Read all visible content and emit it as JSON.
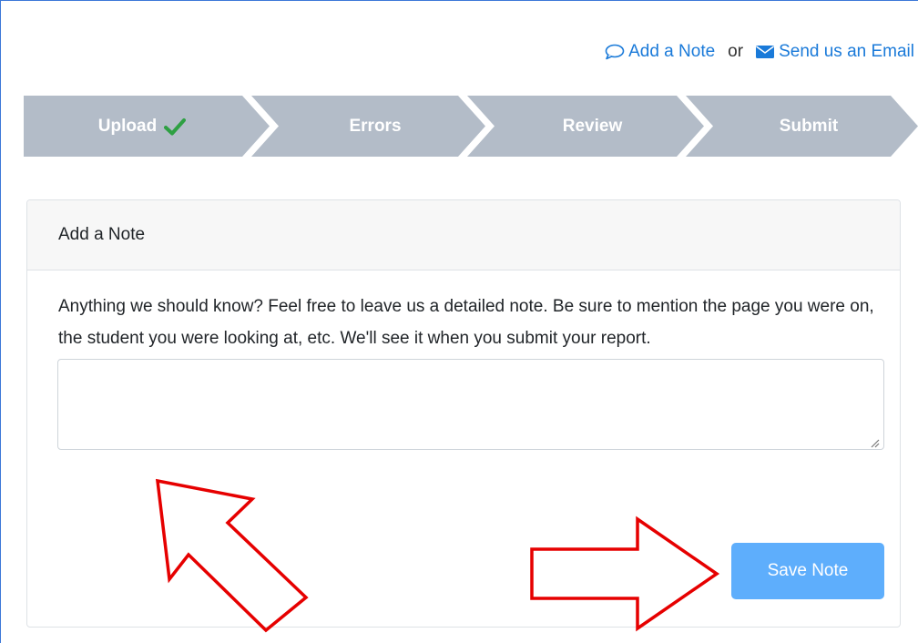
{
  "links": {
    "add_note": "Add a Note",
    "or": "or",
    "send_email": "Send us an Email"
  },
  "steps": [
    {
      "label": "Upload",
      "completed": true
    },
    {
      "label": "Errors",
      "completed": false
    },
    {
      "label": "Review",
      "completed": false
    },
    {
      "label": "Submit",
      "completed": false
    }
  ],
  "panel": {
    "title": "Add a Note",
    "description": "Anything we should know? Feel free to leave us a detailed note. Be sure to mention the page you were on, the student you were looking at, etc. We'll see it when you submit your report.",
    "note_value": "",
    "save_label": "Save Note"
  },
  "colors": {
    "link": "#1a7ad9",
    "step_bg": "#b3bcc8",
    "check": "#2ea043",
    "save_button": "#5eaefc",
    "annotation_arrow": "#e60000"
  },
  "icons": {
    "add_note": "speech-bubble-icon",
    "send_email": "envelope-icon",
    "upload_done": "checkmark-icon"
  }
}
